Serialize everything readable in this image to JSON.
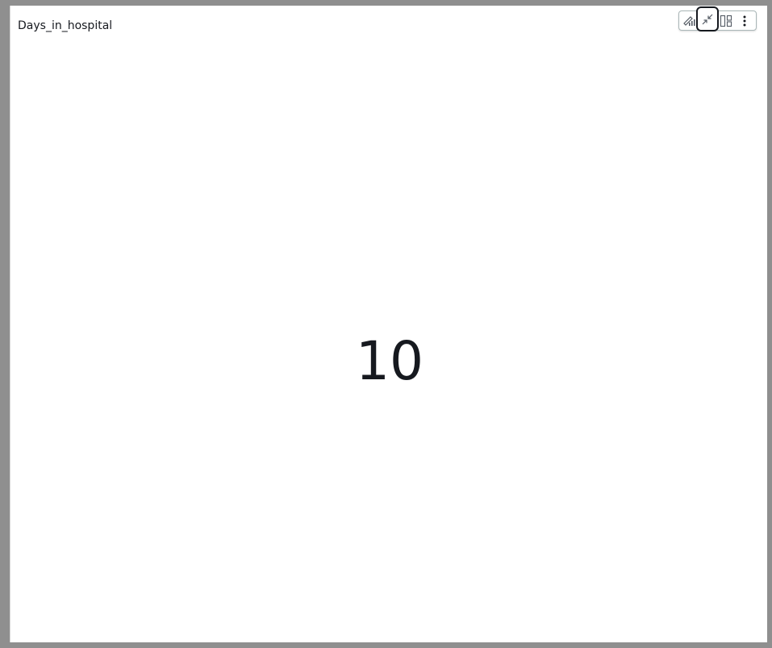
{
  "visual": {
    "title": "Days_in_hospital",
    "kpi_value": "10"
  },
  "toolbar": {
    "buttons": [
      {
        "name": "visual-type-icon"
      },
      {
        "name": "collapse-icon"
      },
      {
        "name": "layout-icon"
      },
      {
        "name": "more-options-icon"
      }
    ]
  },
  "colors": {
    "background": "#8f8f8f",
    "panel": "#ffffff",
    "text": "#16191f",
    "toolbar_border": "#aab7b8"
  }
}
